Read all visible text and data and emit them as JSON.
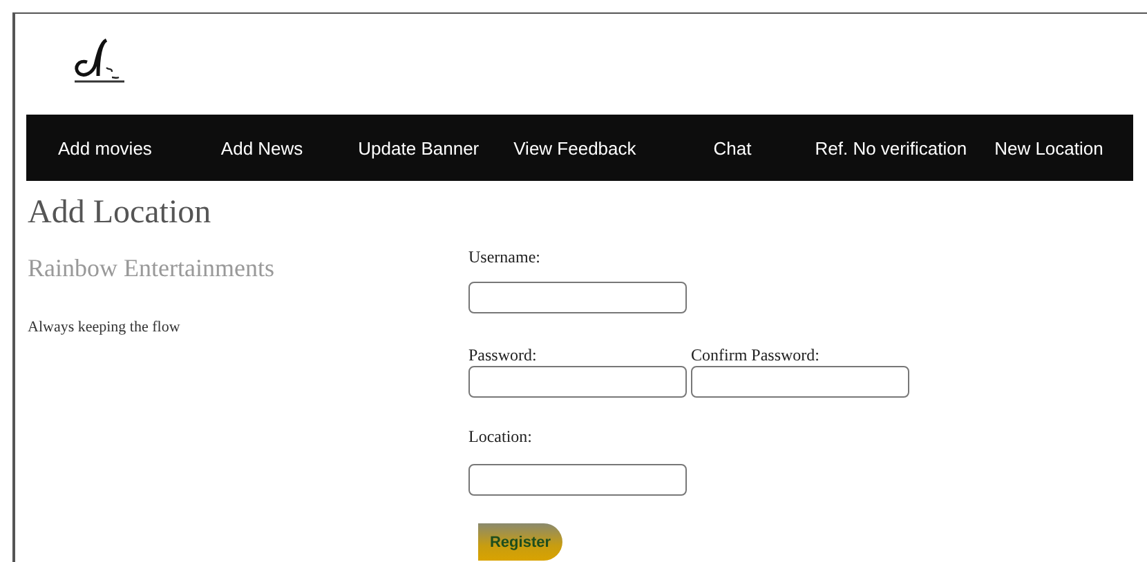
{
  "nav": [
    {
      "label": "Add movies"
    },
    {
      "label": "Add News"
    },
    {
      "label": "Update Banner"
    },
    {
      "label": "View Feedback"
    },
    {
      "label": "Chat"
    },
    {
      "label": "Ref. No verification"
    },
    {
      "label": "New Location"
    }
  ],
  "page_title": "Add Location",
  "sidebar": {
    "title": "Rainbow Entertainments",
    "tagline": "Always keeping the flow"
  },
  "form": {
    "username_label": "Username:",
    "password_label": "Password:",
    "confirm_label": "Confirm Password:",
    "location_label": "Location:",
    "submit": "Register"
  }
}
